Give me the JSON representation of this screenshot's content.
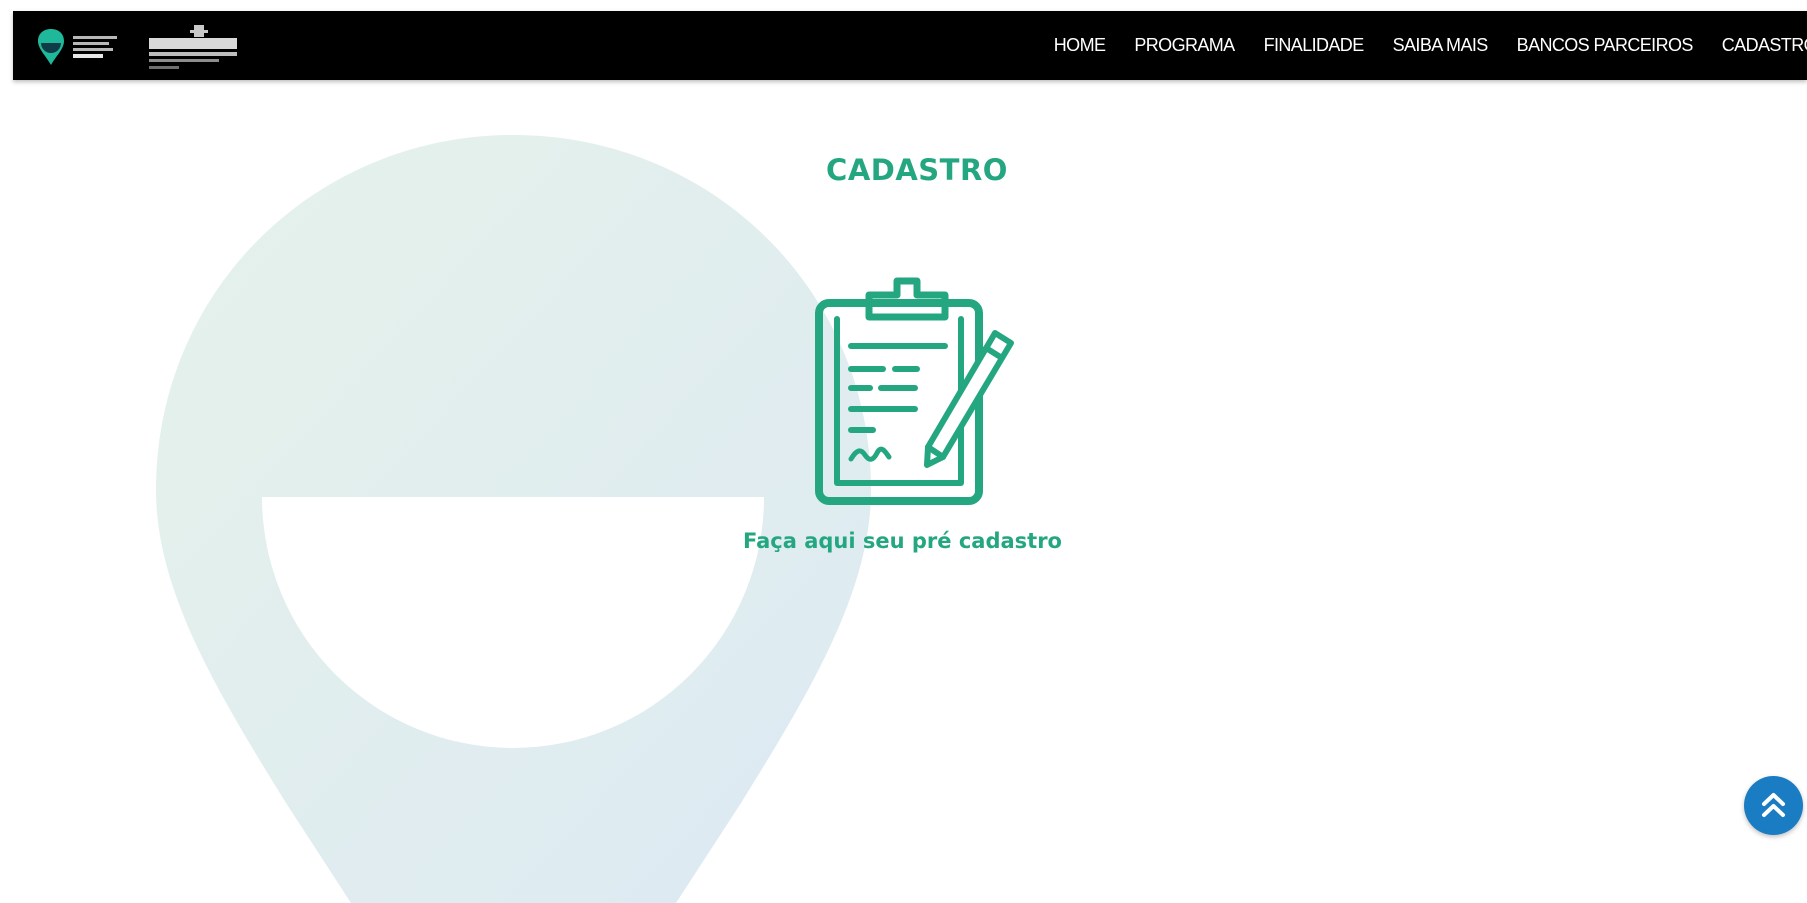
{
  "nav": {
    "items": [
      {
        "label": "HOME"
      },
      {
        "label": "PROGRAMA"
      },
      {
        "label": "FINALIDADE"
      },
      {
        "label": "SAIBA MAIS"
      },
      {
        "label": "BANCOS PARCEIROS"
      },
      {
        "label": "CADASTRO"
      }
    ]
  },
  "section": {
    "title": "CADASTRO",
    "cta_text": "Faça aqui seu pré cadastro",
    "icon": "clipboard-signature-icon"
  },
  "colors": {
    "accent_green": "#24a780",
    "navbar_bg": "#000000",
    "back_to_top_bg": "#1a7cc3",
    "pin_watermark_start": "#e6f2ea",
    "pin_watermark_end": "#dce9f3"
  },
  "icons": {
    "back_to_top": "double-chevron-up-icon",
    "logo_left": "map-pin-logo-icon",
    "logo_right": "sao-paulo-logo-icon"
  }
}
